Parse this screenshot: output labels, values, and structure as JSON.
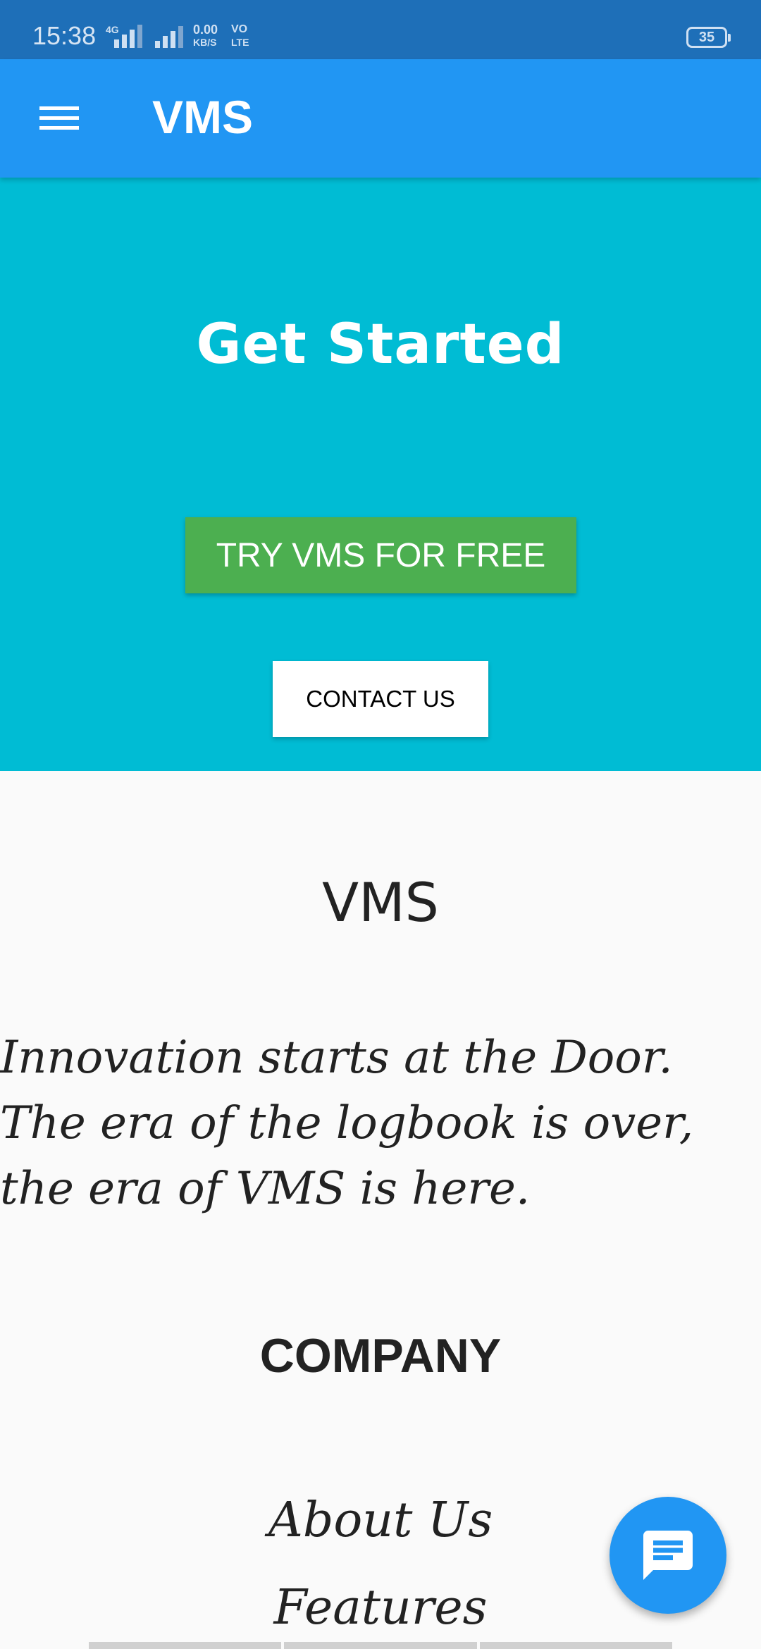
{
  "status_bar": {
    "time": "15:38",
    "network_1": "4G",
    "speed_value": "0.00",
    "speed_unit": "KB/S",
    "volte_top": "VO",
    "volte_bottom": "LTE",
    "battery": "35"
  },
  "app_bar": {
    "title": "VMS",
    "menu_icon": "hamburger-menu-icon"
  },
  "hero": {
    "title": "Get Started",
    "try_button": "TRY VMS FOR FREE",
    "contact_button": "CONTACT US",
    "background": "#00bcd4",
    "try_color": "#4caf50"
  },
  "about": {
    "heading": "VMS",
    "tagline": "Innovation starts at the Door. The era of the logbook is over, the era of VMS is here."
  },
  "company": {
    "heading": "COMPANY",
    "links": [
      "About Us",
      "Features"
    ]
  },
  "fab": {
    "icon": "chat-message-icon"
  },
  "colors": {
    "primary": "#2196f3",
    "status_bar": "#1e6fb8"
  }
}
